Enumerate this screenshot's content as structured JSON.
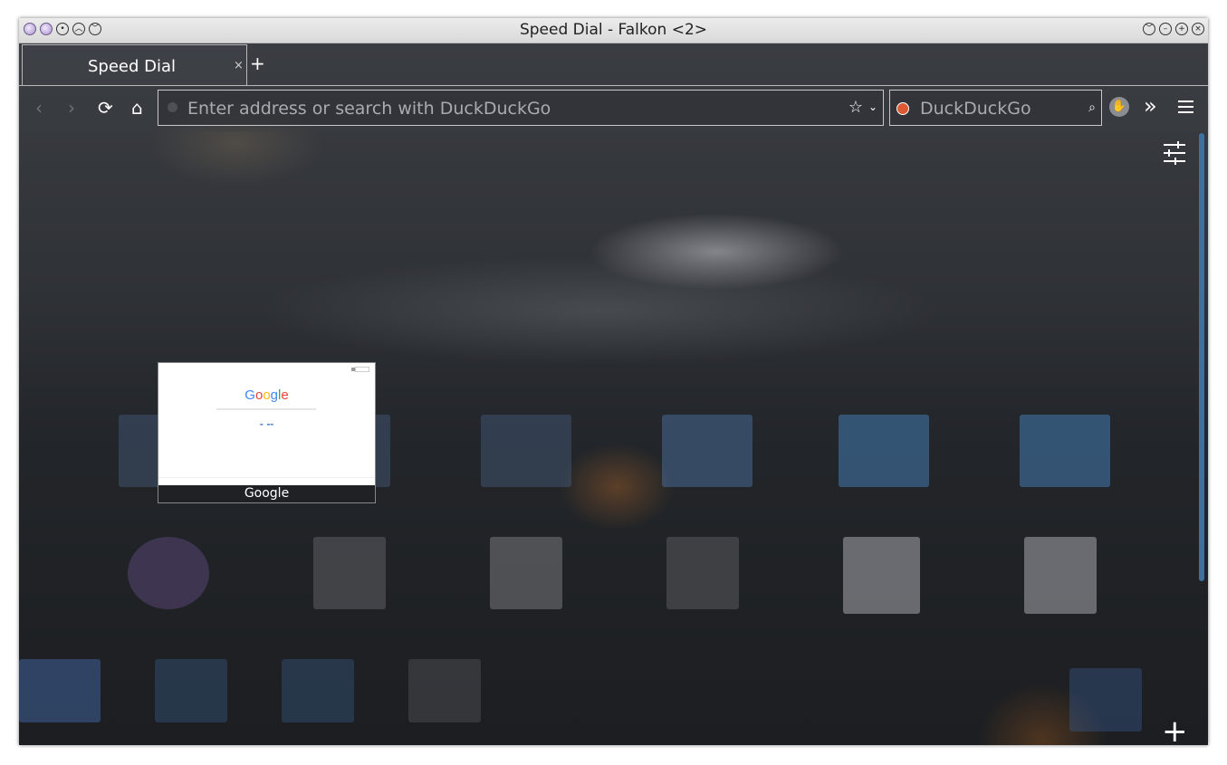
{
  "window": {
    "title": "Speed Dial - Falkon <2>"
  },
  "titlebar_buttons": {
    "left": [
      "app-icon",
      "app-icon",
      "pin-icon",
      "keep-above-icon",
      "keep-below-icon"
    ],
    "right": [
      "shade-icon",
      "minimize-icon",
      "maximize-icon",
      "close-icon"
    ]
  },
  "tabs": [
    {
      "label": "Speed Dial",
      "close": "×"
    }
  ],
  "new_tab_label": "+",
  "navbar": {
    "back": "‹",
    "forward": "›",
    "reload": "⟳",
    "home": "⌂",
    "address_placeholder": "Enter address or search with DuckDuckGo",
    "address_value": "",
    "bookmark_star": "☆",
    "dropdown_caret": "⌄",
    "search_engine": "DuckDuckGo",
    "search_placeholder": "DuckDuckGo",
    "search_glass": "⌕",
    "adblock": "✋",
    "overflow": "»"
  },
  "speed_dial": {
    "tiles": [
      {
        "title": "Google",
        "thumbnail_text": "Google"
      }
    ],
    "add_label": "+"
  },
  "colors": {
    "accent": "#3d6fa0",
    "google_blue": "#4285f4",
    "google_red": "#ea4335",
    "google_yellow": "#fbbc05",
    "google_green": "#34a853",
    "duckduckgo": "#de5833"
  }
}
